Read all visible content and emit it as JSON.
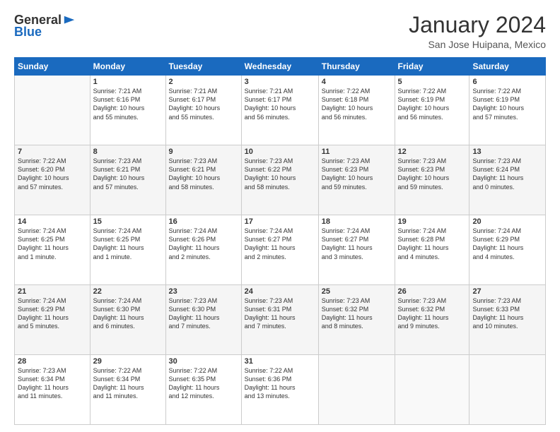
{
  "header": {
    "logo_general": "General",
    "logo_blue": "Blue",
    "month_title": "January 2024",
    "location": "San Jose Huipana, Mexico"
  },
  "days_of_week": [
    "Sunday",
    "Monday",
    "Tuesday",
    "Wednesday",
    "Thursday",
    "Friday",
    "Saturday"
  ],
  "weeks": [
    [
      {
        "num": "",
        "info": ""
      },
      {
        "num": "1",
        "info": "Sunrise: 7:21 AM\nSunset: 6:16 PM\nDaylight: 10 hours\nand 55 minutes."
      },
      {
        "num": "2",
        "info": "Sunrise: 7:21 AM\nSunset: 6:17 PM\nDaylight: 10 hours\nand 55 minutes."
      },
      {
        "num": "3",
        "info": "Sunrise: 7:21 AM\nSunset: 6:17 PM\nDaylight: 10 hours\nand 56 minutes."
      },
      {
        "num": "4",
        "info": "Sunrise: 7:22 AM\nSunset: 6:18 PM\nDaylight: 10 hours\nand 56 minutes."
      },
      {
        "num": "5",
        "info": "Sunrise: 7:22 AM\nSunset: 6:19 PM\nDaylight: 10 hours\nand 56 minutes."
      },
      {
        "num": "6",
        "info": "Sunrise: 7:22 AM\nSunset: 6:19 PM\nDaylight: 10 hours\nand 57 minutes."
      }
    ],
    [
      {
        "num": "7",
        "info": "Sunrise: 7:22 AM\nSunset: 6:20 PM\nDaylight: 10 hours\nand 57 minutes."
      },
      {
        "num": "8",
        "info": "Sunrise: 7:23 AM\nSunset: 6:21 PM\nDaylight: 10 hours\nand 57 minutes."
      },
      {
        "num": "9",
        "info": "Sunrise: 7:23 AM\nSunset: 6:21 PM\nDaylight: 10 hours\nand 58 minutes."
      },
      {
        "num": "10",
        "info": "Sunrise: 7:23 AM\nSunset: 6:22 PM\nDaylight: 10 hours\nand 58 minutes."
      },
      {
        "num": "11",
        "info": "Sunrise: 7:23 AM\nSunset: 6:23 PM\nDaylight: 10 hours\nand 59 minutes."
      },
      {
        "num": "12",
        "info": "Sunrise: 7:23 AM\nSunset: 6:23 PM\nDaylight: 10 hours\nand 59 minutes."
      },
      {
        "num": "13",
        "info": "Sunrise: 7:23 AM\nSunset: 6:24 PM\nDaylight: 11 hours\nand 0 minutes."
      }
    ],
    [
      {
        "num": "14",
        "info": "Sunrise: 7:24 AM\nSunset: 6:25 PM\nDaylight: 11 hours\nand 1 minute."
      },
      {
        "num": "15",
        "info": "Sunrise: 7:24 AM\nSunset: 6:25 PM\nDaylight: 11 hours\nand 1 minute."
      },
      {
        "num": "16",
        "info": "Sunrise: 7:24 AM\nSunset: 6:26 PM\nDaylight: 11 hours\nand 2 minutes."
      },
      {
        "num": "17",
        "info": "Sunrise: 7:24 AM\nSunset: 6:27 PM\nDaylight: 11 hours\nand 2 minutes."
      },
      {
        "num": "18",
        "info": "Sunrise: 7:24 AM\nSunset: 6:27 PM\nDaylight: 11 hours\nand 3 minutes."
      },
      {
        "num": "19",
        "info": "Sunrise: 7:24 AM\nSunset: 6:28 PM\nDaylight: 11 hours\nand 4 minutes."
      },
      {
        "num": "20",
        "info": "Sunrise: 7:24 AM\nSunset: 6:29 PM\nDaylight: 11 hours\nand 4 minutes."
      }
    ],
    [
      {
        "num": "21",
        "info": "Sunrise: 7:24 AM\nSunset: 6:29 PM\nDaylight: 11 hours\nand 5 minutes."
      },
      {
        "num": "22",
        "info": "Sunrise: 7:24 AM\nSunset: 6:30 PM\nDaylight: 11 hours\nand 6 minutes."
      },
      {
        "num": "23",
        "info": "Sunrise: 7:23 AM\nSunset: 6:30 PM\nDaylight: 11 hours\nand 7 minutes."
      },
      {
        "num": "24",
        "info": "Sunrise: 7:23 AM\nSunset: 6:31 PM\nDaylight: 11 hours\nand 7 minutes."
      },
      {
        "num": "25",
        "info": "Sunrise: 7:23 AM\nSunset: 6:32 PM\nDaylight: 11 hours\nand 8 minutes."
      },
      {
        "num": "26",
        "info": "Sunrise: 7:23 AM\nSunset: 6:32 PM\nDaylight: 11 hours\nand 9 minutes."
      },
      {
        "num": "27",
        "info": "Sunrise: 7:23 AM\nSunset: 6:33 PM\nDaylight: 11 hours\nand 10 minutes."
      }
    ],
    [
      {
        "num": "28",
        "info": "Sunrise: 7:23 AM\nSunset: 6:34 PM\nDaylight: 11 hours\nand 11 minutes."
      },
      {
        "num": "29",
        "info": "Sunrise: 7:22 AM\nSunset: 6:34 PM\nDaylight: 11 hours\nand 11 minutes."
      },
      {
        "num": "30",
        "info": "Sunrise: 7:22 AM\nSunset: 6:35 PM\nDaylight: 11 hours\nand 12 minutes."
      },
      {
        "num": "31",
        "info": "Sunrise: 7:22 AM\nSunset: 6:36 PM\nDaylight: 11 hours\nand 13 minutes."
      },
      {
        "num": "",
        "info": ""
      },
      {
        "num": "",
        "info": ""
      },
      {
        "num": "",
        "info": ""
      }
    ]
  ]
}
